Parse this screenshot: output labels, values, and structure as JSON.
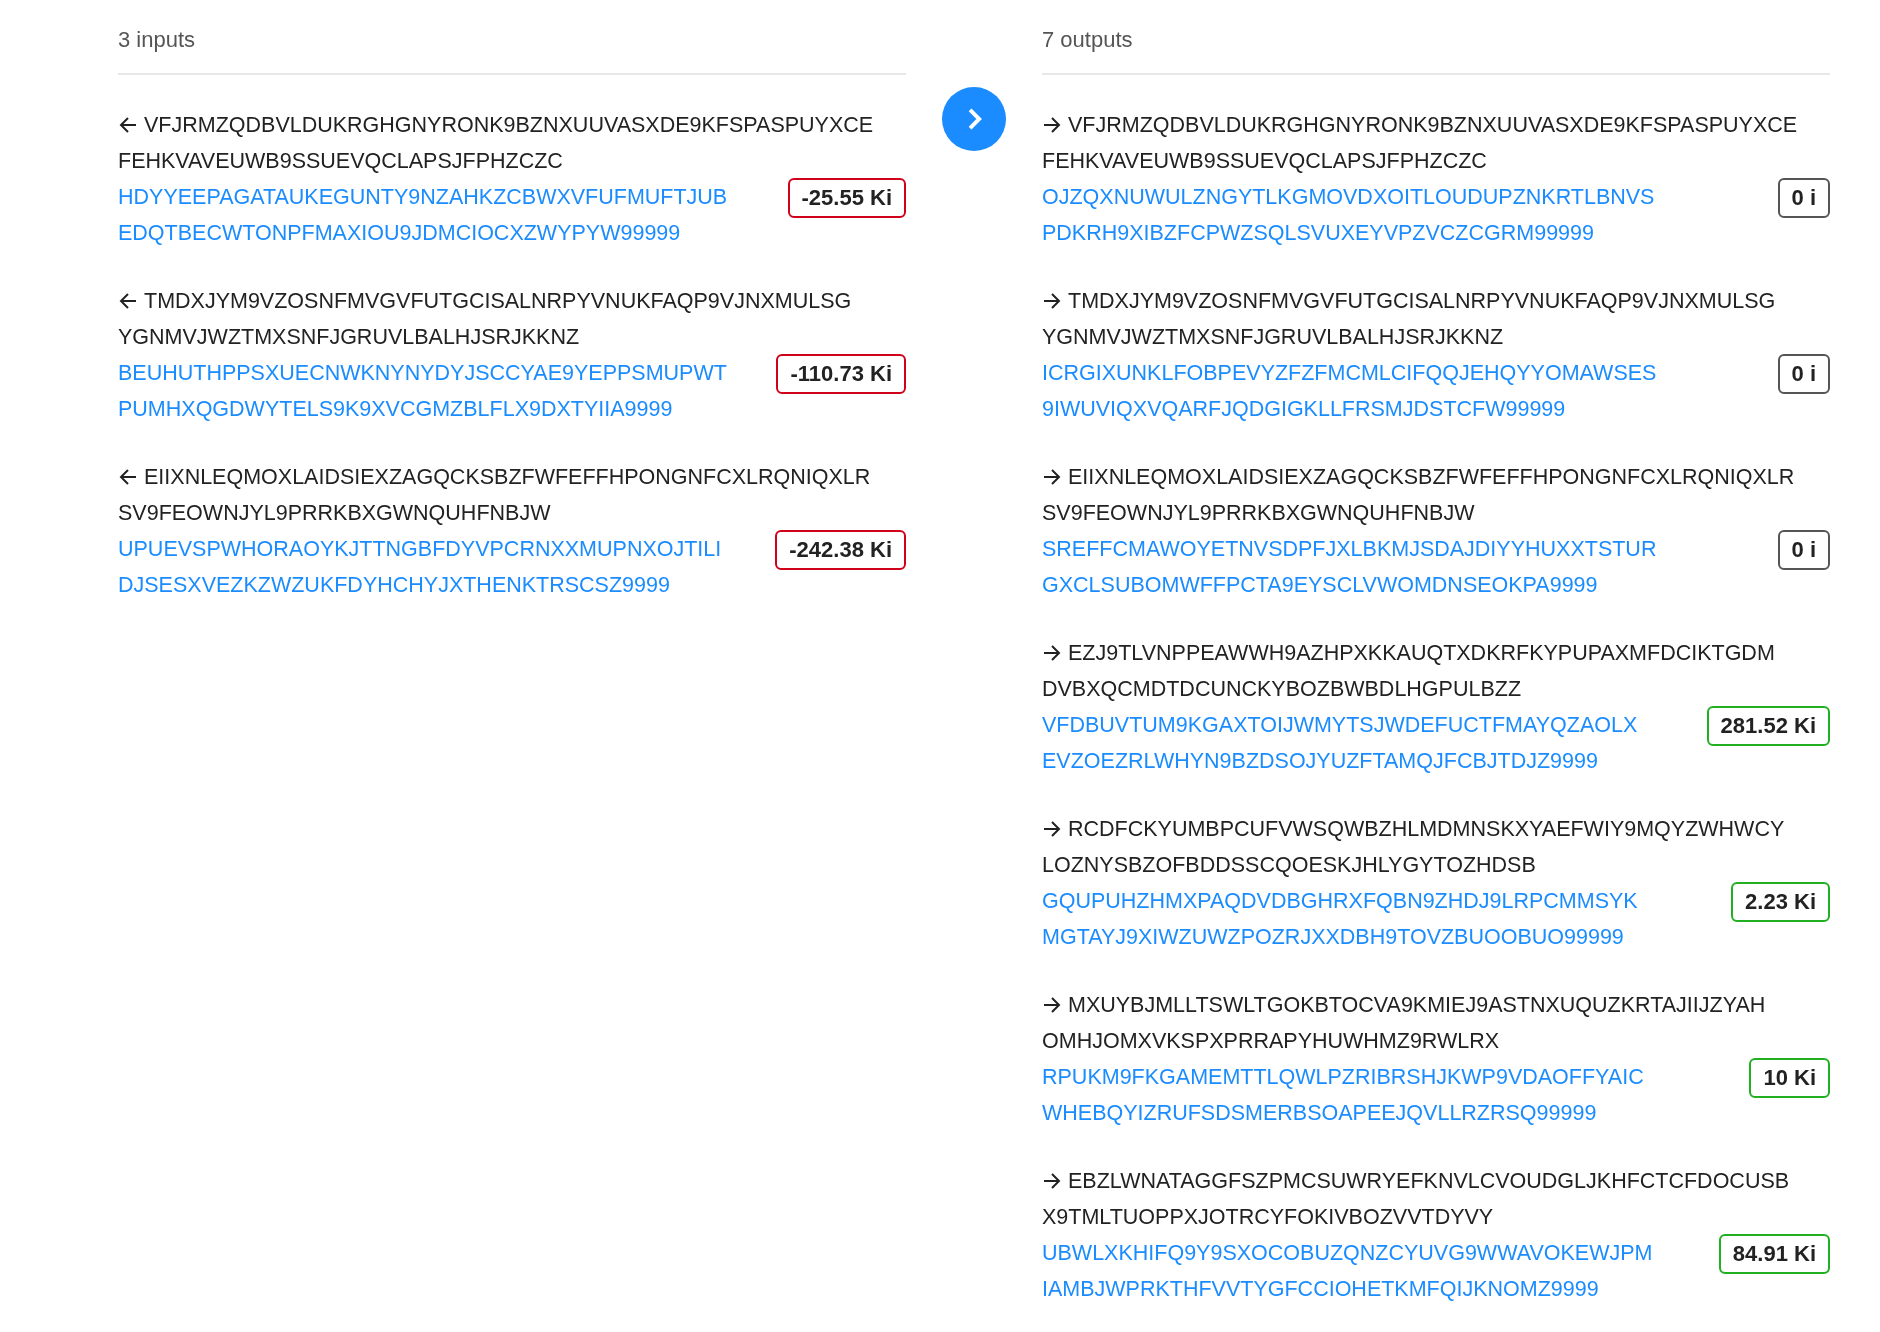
{
  "columns": [
    {
      "heading": "3 inputs",
      "kind": "in",
      "items": [
        {
          "address_lines": [
            "VFJRMZQDBVLDUKRGHGNYRONK9BZNXUUVASXDE9KFSPASPUYXCE",
            "FEHKVAVEUWB9SSUEVQCLAPSJFPHZCZC"
          ],
          "bundle_lines": [
            "HDYYEEPAGATAUKEGUNTY9NZAHKZCBWXVFUFMUFTJUB",
            "EDQTBECWTONPFMAXIOU9JDMCIOCXZWYPYW99999"
          ],
          "value": "-25.55 Ki",
          "color": "#d0021b"
        },
        {
          "address_lines": [
            "TMDXJYM9VZOSNFMVGVFUTGCISALNRPYVNUKFAQP9VJNXMULSG",
            "YGNMVJWZTMXSNFJGRUVLBALHJSRJKKNZ"
          ],
          "bundle_lines": [
            "BEUHUTHPPSXUECNWKNYNYDYJSCCYAE9YEPPSMUPWT",
            "PUMHXQGDWYTELS9K9XVCGMZBLFLX9DXTYIIA9999"
          ],
          "value": "-110.73 Ki",
          "color": "#d0021b"
        },
        {
          "address_lines": [
            "EIIXNLEQMOXLAIDSIEXZAGQCKSBZFWFEFFHPONGNFCXLRQNIQXLR",
            "SV9FEOWNJYL9PRRKBXGWNQUHFNBJW"
          ],
          "bundle_lines": [
            "UPUEVSPWHORAOYKJTTNGBFDYVPCRNXXMUPNXOJTILI",
            "DJSESXVEZKZWZUKFDYHCHYJXTHENKTRSCSZ9999"
          ],
          "value": "-242.38 Ki",
          "color": "#d0021b"
        }
      ]
    },
    {
      "heading": "7 outputs",
      "kind": "out",
      "items": [
        {
          "address_lines": [
            "VFJRMZQDBVLDUKRGHGNYRONK9BZNXUUVASXDE9KFSPASPUYXCE",
            "FEHKVAVEUWB9SSUEVQCLAPSJFPHZCZC"
          ],
          "bundle_lines": [
            "OJZQXNUWULZNGYTLKGMOVDXOITLOUDUPZNKRTLBNVS",
            "PDKRH9XIBZFCPWZSQLSVUXEYVPZVCZCGRM99999"
          ],
          "value": "0 i",
          "color": "#555555"
        },
        {
          "address_lines": [
            "TMDXJYM9VZOSNFMVGVFUTGCISALNRPYVNUKFAQP9VJNXMULSG",
            "YGNMVJWZTMXSNFJGRUVLBALHJSRJKKNZ"
          ],
          "bundle_lines": [
            "ICRGIXUNKLFOBPEVYZFZFMCMLCIFQQJEHQYYOMAWSES",
            "9IWUVIQXVQARFJQDGIGKLLFRSMJDSTCFW99999"
          ],
          "value": "0 i",
          "color": "#555555"
        },
        {
          "address_lines": [
            "EIIXNLEQMOXLAIDSIEXZAGQCKSBZFWFEFFHPONGNFCXLRQNIQXLR",
            "SV9FEOWNJYL9PRRKBXGWNQUHFNBJW"
          ],
          "bundle_lines": [
            "SREFFCMAWOYETNVSDPFJXLBKMJSDAJDIYYHUXXTSTUR",
            "GXCLSUBOMWFFPCTA9EYSCLVWOMDNSEOKPA9999"
          ],
          "value": "0 i",
          "color": "#555555"
        },
        {
          "address_lines": [
            "EZJ9TLVNPPEAWWH9AZHPXKKAUQTXDKRFKYPUPAXMFDCIKTGDM",
            "DVBXQCMDTDCUNCKYBOZBWBDLHGPULBZZ"
          ],
          "bundle_lines": [
            "VFDBUVTUM9KGAXTOIJWMYTSJWDEFUCTFMAYQZAOLX",
            "EVZOEZRLWHYN9BZDSOJYUZFTAMQJFCBJTDJZ9999"
          ],
          "value": "281.52 Ki",
          "color": "#22b022"
        },
        {
          "address_lines": [
            "RCDFCKYUMBPCUFVWSQWBZHLMDMNSKXYAEFWIY9MQYZWHWCY",
            "LOZNYSBZOFBDDSSCQOESKJHLYGYTOZHDSB"
          ],
          "bundle_lines": [
            "GQUPUHZHMXPAQDVDBGHRXFQBN9ZHDJ9LRPCMMSYK",
            "MGTAYJ9XIWZUWZPOZRJXXDBH9TOVZBUOOBUO99999"
          ],
          "value": "2.23 Ki",
          "color": "#22b022"
        },
        {
          "address_lines": [
            "MXUYBJMLLTSWLTGOKBTOCVA9KMIEJ9ASTNXUQUZKRTAJIIJZYAH",
            "OMHJOMXVKSPXPRRAPYHUWHMZ9RWLRX"
          ],
          "bundle_lines": [
            "RPUKM9FKGAMEMTTLQWLPZRIBRSHJKWP9VDAOFFYAIC",
            "WHEBQYIZRUFSDSMERBSOAPEEJQVLLRZRSQ99999"
          ],
          "value": "10 Ki",
          "color": "#22b022"
        },
        {
          "address_lines": [
            "EBZLWNATAGGFSZPMCSUWRYEFKNVLCVOUDGLJKHFCTCFDOCUSB",
            "X9TMLTUOPPXJOTRCYFOKIVBOZVVTDYVY"
          ],
          "bundle_lines": [
            "UBWLXKHIFQ9Y9SXOCOBUZQNZCYUVG9WWAVOKEWJPM",
            "IAMBJWPRKTHFVVTYGFCCIOHETKMFQIJKNOMZ9999"
          ],
          "value": "84.91 Ki",
          "color": "#22b022"
        }
      ]
    }
  ],
  "next_button": {
    "kind": "chevron-right"
  }
}
